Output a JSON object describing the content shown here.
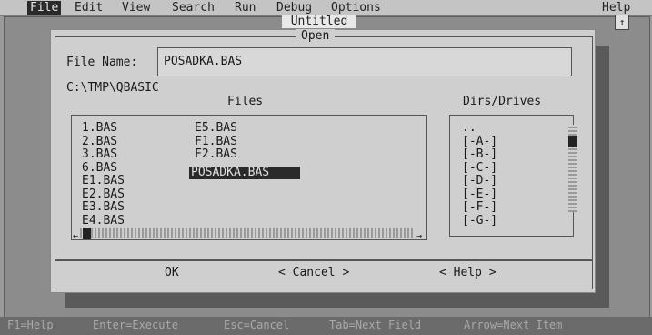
{
  "menu": {
    "items": [
      {
        "label": "File",
        "active": true
      },
      {
        "label": "Edit"
      },
      {
        "label": "View"
      },
      {
        "label": "Search"
      },
      {
        "label": "Run"
      },
      {
        "label": "Debug"
      },
      {
        "label": "Options"
      }
    ],
    "help": "Help"
  },
  "editor": {
    "title": "Untitled"
  },
  "dialog": {
    "title": "Open",
    "file_name_label": "File Name:",
    "file_name_value": "POSADKA.BAS",
    "current_path": "C:\\TMP\\QBASIC",
    "files_label": "Files",
    "files_col1": [
      "1.BAS",
      "2.BAS",
      "3.BAS",
      "6.BAS",
      "E1.BAS",
      "E2.BAS",
      "E3.BAS",
      "E4.BAS"
    ],
    "files_col2": [
      "E5.BAS",
      "F1.BAS",
      "F2.BAS",
      "POSADKA.BAS"
    ],
    "selected_file": "POSADKA.BAS",
    "dirs_label": "Dirs/Drives",
    "dirs": [
      "..",
      "[-A-]",
      "[-B-]",
      "[-C-]",
      "[-D-]",
      "[-E-]",
      "[-F-]",
      "[-G-]"
    ],
    "buttons": {
      "ok": "OK",
      "cancel": "< Cancel >",
      "help": "< Help >"
    }
  },
  "status": {
    "items": [
      "F1=Help",
      "Enter=Execute",
      "Esc=Cancel",
      "Tab=Next Field",
      "Arrow=Next Item"
    ]
  }
}
